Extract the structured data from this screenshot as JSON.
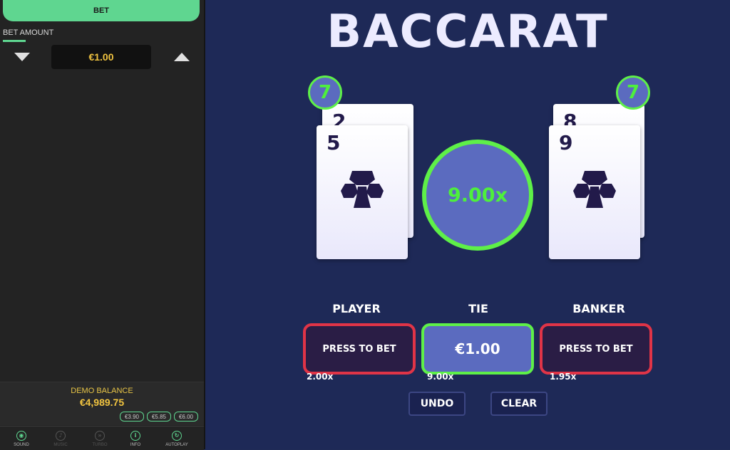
{
  "sidebar": {
    "bet_button": "BET",
    "bet_amount_label": "BET AMOUNT",
    "bet_amount_value": "€1.00",
    "demo_balance_label": "DEMO BALANCE",
    "demo_balance_value": "€4,989.75",
    "chips": [
      "€3.90",
      "€5.85",
      "€6.00"
    ],
    "bottom_bar": [
      {
        "label": "SOUND",
        "icon": "sound-icon",
        "active": true
      },
      {
        "label": "MUSIC",
        "icon": "music-icon",
        "active": false
      },
      {
        "label": "TURBO",
        "icon": "turbo-icon",
        "active": false
      },
      {
        "label": "INFO",
        "icon": "info-icon",
        "active": true
      },
      {
        "label": "AUTOPLAY",
        "icon": "autoplay-icon",
        "active": true
      }
    ]
  },
  "game": {
    "title": "BACCARAT",
    "player": {
      "score": "7",
      "cards": [
        {
          "rank": "2",
          "suit": "clubs"
        },
        {
          "rank": "5",
          "suit": "clubs"
        }
      ]
    },
    "banker": {
      "score": "7",
      "cards": [
        {
          "rank": "8",
          "suit": "clubs"
        },
        {
          "rank": "9",
          "suit": "clubs"
        }
      ]
    },
    "multiplier": "9.00x",
    "zones": {
      "player": {
        "label": "PLAYER",
        "bet": "PRESS TO BET",
        "payout": "2.00x"
      },
      "tie": {
        "label": "TIE",
        "bet": "€1.00",
        "payout": "9.00x"
      },
      "banker": {
        "label": "BANKER",
        "bet": "PRESS TO BET",
        "payout": "1.95x"
      }
    },
    "undo_label": "UNDO",
    "clear_label": "CLEAR"
  },
  "colors": {
    "accent_green": "#5fd690",
    "win_green": "#5ef048",
    "bet_red": "#e03447",
    "balance_gold": "#f1c440",
    "table_blue": "#1e2957"
  }
}
